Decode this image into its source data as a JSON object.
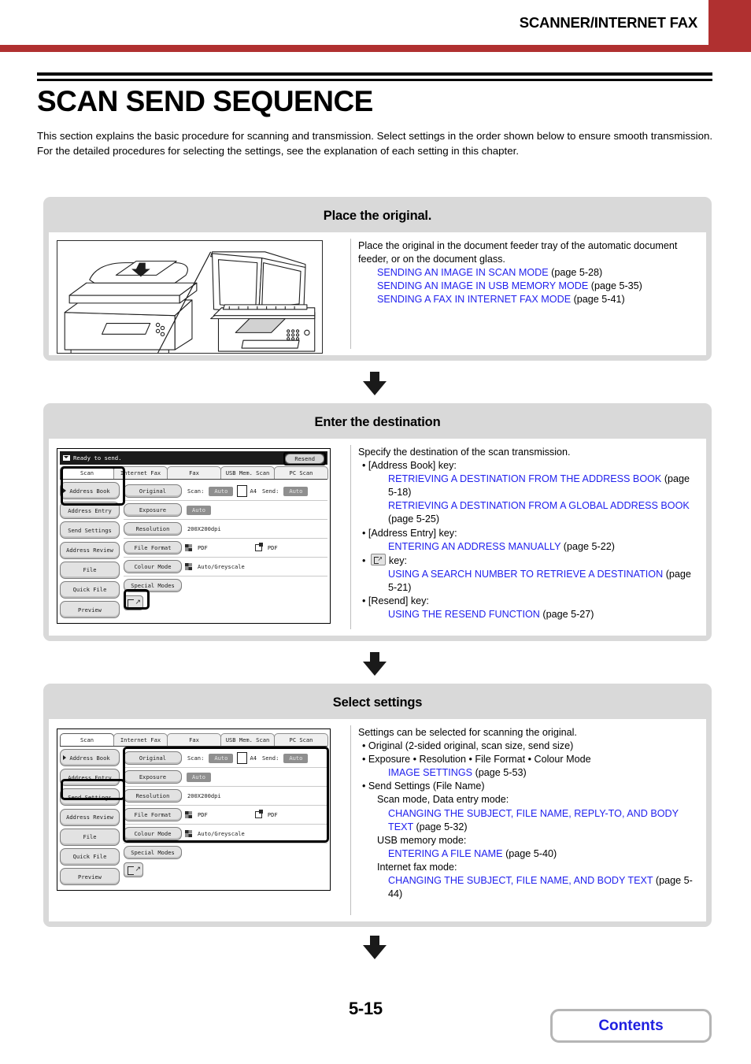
{
  "header": {
    "chapter_title": "SCANNER/INTERNET FAX",
    "accent_color": "#b03030"
  },
  "page": {
    "title": "SCAN SEND SEQUENCE",
    "intro_line1": "This section explains the basic procedure for scanning and transmission. Select settings in the order shown below to ensure smooth transmission.",
    "intro_line2": "For the detailed procedures for selecting the settings, see the explanation of each setting in this chapter.",
    "page_number": "5-15",
    "contents_label": "Contents",
    "link_color": "#2222ee"
  },
  "steps": [
    {
      "heading": "Place the original.",
      "illustration": "mfp-document-feeder-and-glass",
      "intro": "Place the original in the document feeder tray of the automatic document feeder, or on the document glass.",
      "links": [
        {
          "text": "SENDING AN IMAGE IN SCAN MODE",
          "page": "(page 5-28)"
        },
        {
          "text": "SENDING AN IMAGE IN USB MEMORY MODE",
          "page": "(page 5-35)"
        },
        {
          "text": "SENDING A FAX IN INTERNET FAX MODE",
          "page": "(page 5-41)"
        }
      ]
    },
    {
      "heading": "Enter the destination",
      "intro": "Specify the destination of the scan transmission.",
      "items": [
        {
          "key": "• [Address Book] key:",
          "links": [
            {
              "text": "RETRIEVING A DESTINATION FROM THE ADDRESS BOOK",
              "page": "(page 5-18)"
            },
            {
              "text": "RETRIEVING A DESTINATION FROM A GLOBAL ADDRESS BOOK",
              "page": "(page 5-25)"
            }
          ]
        },
        {
          "key": "• [Address Entry] key:",
          "links": [
            {
              "text": "ENTERING AN ADDRESS MANUALLY",
              "page": "(page 5-22)"
            }
          ]
        },
        {
          "key": "• [search-number] key:",
          "icon": "search-number-key-icon",
          "key_suffix": "key:",
          "links": [
            {
              "text": "USING A SEARCH NUMBER TO RETRIEVE A DESTINATION",
              "page": "(page 5-21)"
            }
          ]
        },
        {
          "key": "• [Resend] key:",
          "links": [
            {
              "text": "USING THE RESEND FUNCTION",
              "page": "(page 5-27)"
            }
          ]
        }
      ]
    },
    {
      "heading": "Select settings",
      "intro": "Settings can be selected for scanning the original.",
      "bullets": [
        "• Original (2-sided original, scan size, send size)",
        "• Exposure  • Resolution  • File Format  • Colour Mode",
        "• Send Settings (File Name)"
      ],
      "image_settings_link": {
        "text": "IMAGE SETTINGS",
        "page": "(page 5-53)"
      },
      "modes": [
        {
          "label": "Scan mode, Data entry mode:",
          "links": [
            {
              "text": "CHANGING THE SUBJECT, FILE NAME, REPLY-TO, AND BODY TEXT",
              "page": "(page 5-32)"
            }
          ]
        },
        {
          "label": "USB memory mode:",
          "links": [
            {
              "text": "ENTERING A FILE NAME",
              "page": "(page 5-40)"
            }
          ]
        },
        {
          "label": "Internet fax mode:",
          "links": [
            {
              "text": "CHANGING THE SUBJECT, FILE NAME, AND BODY TEXT",
              "page": "(page 5-44)"
            }
          ]
        }
      ]
    }
  ],
  "lcd": {
    "status_text": "Ready to send.",
    "status_icon": "mail-icon",
    "resend_label": "Resend",
    "tabs": [
      "Scan",
      "Internet Fax",
      "Fax",
      "USB Mem. Scan",
      "PC Scan"
    ],
    "selected_tab": "Scan",
    "side_keys": [
      "Address Book",
      "Address Entry",
      "Send Settings",
      "Address Review",
      "File",
      "Quick File",
      "Preview"
    ],
    "rows": [
      {
        "key": "Original",
        "scan_label": "Scan:",
        "scan_value": "Auto",
        "size_value": "A4",
        "send_label": "Send:",
        "send_value": "Auto"
      },
      {
        "key": "Exposure",
        "value": "Auto"
      },
      {
        "key": "Resolution",
        "value": "200X200dpi"
      },
      {
        "key": "File Format",
        "value": "PDF",
        "value2": "PDF"
      },
      {
        "key": "Colour Mode",
        "value": "Auto/Greyscale"
      },
      {
        "key": "Special Modes"
      }
    ],
    "arrow_key_icon": "search-number-key-icon"
  }
}
